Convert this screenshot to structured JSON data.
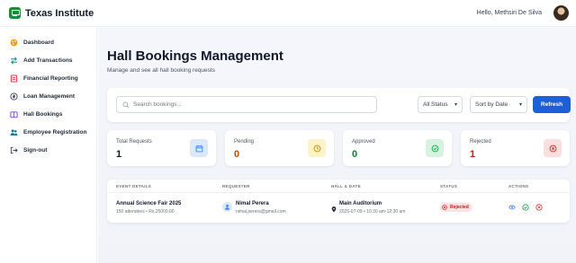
{
  "app": {
    "title": "Texas Institute",
    "greeting": "Hello, Methsiri De Silva"
  },
  "sidebar": {
    "items": [
      {
        "label": "Dashboard",
        "icon": "palette-icon"
      },
      {
        "label": "Add Transactions",
        "icon": "swap-icon"
      },
      {
        "label": "Financial Reporting",
        "icon": "report-icon"
      },
      {
        "label": "Loan Management",
        "icon": "loan-icon"
      },
      {
        "label": "Hall Bookings",
        "icon": "booking-icon"
      },
      {
        "label": "Employee Registration",
        "icon": "users-icon"
      },
      {
        "label": "Sign-out",
        "icon": "signout-icon"
      }
    ]
  },
  "page": {
    "title": "Hall Bookings Management",
    "subtitle": "Manage and see all hall booking requests"
  },
  "filters": {
    "search_placeholder": "Search bookings...",
    "status_value": "All Status",
    "sort_value": "Sort by Date",
    "refresh_label": "Refresh"
  },
  "stats": [
    {
      "label": "Total Requests",
      "value": "1",
      "color": "#111827",
      "icon": "calendar-icon",
      "icon_bg": "#dbe8f7",
      "icon_color": "#3b82f6"
    },
    {
      "label": "Pending",
      "value": "0",
      "color": "#b45309",
      "icon": "clock-icon",
      "icon_bg": "#fcf3c6",
      "icon_color": "#ca8a04"
    },
    {
      "label": "Approved",
      "value": "0",
      "color": "#15803d",
      "icon": "check-circle-icon",
      "icon_bg": "#d7f3df",
      "icon_color": "#16a34a"
    },
    {
      "label": "Rejected",
      "value": "1",
      "color": "#b91c1c",
      "icon": "x-circle-icon",
      "icon_bg": "#fbdede",
      "icon_color": "#dc2626"
    }
  ],
  "table": {
    "headers": [
      "EVENT DETAILS",
      "REQUESTER",
      "HALL & DATE",
      "STATUS",
      "ACTIONS"
    ],
    "rows": [
      {
        "event_name": "Annual Science Fair 2025",
        "event_meta": "150 attendees • Rs.25000.00",
        "requester_name": "Nimal Perera",
        "requester_email": "nimal.perera@gmail.com",
        "hall": "Main Auditorium",
        "datetime": "2025-07-09 • 10:30 am-12:30 am",
        "status": "Rejected"
      }
    ]
  },
  "colors": {
    "accent": "#1d5fd6",
    "brand": "#1f8a3a"
  }
}
